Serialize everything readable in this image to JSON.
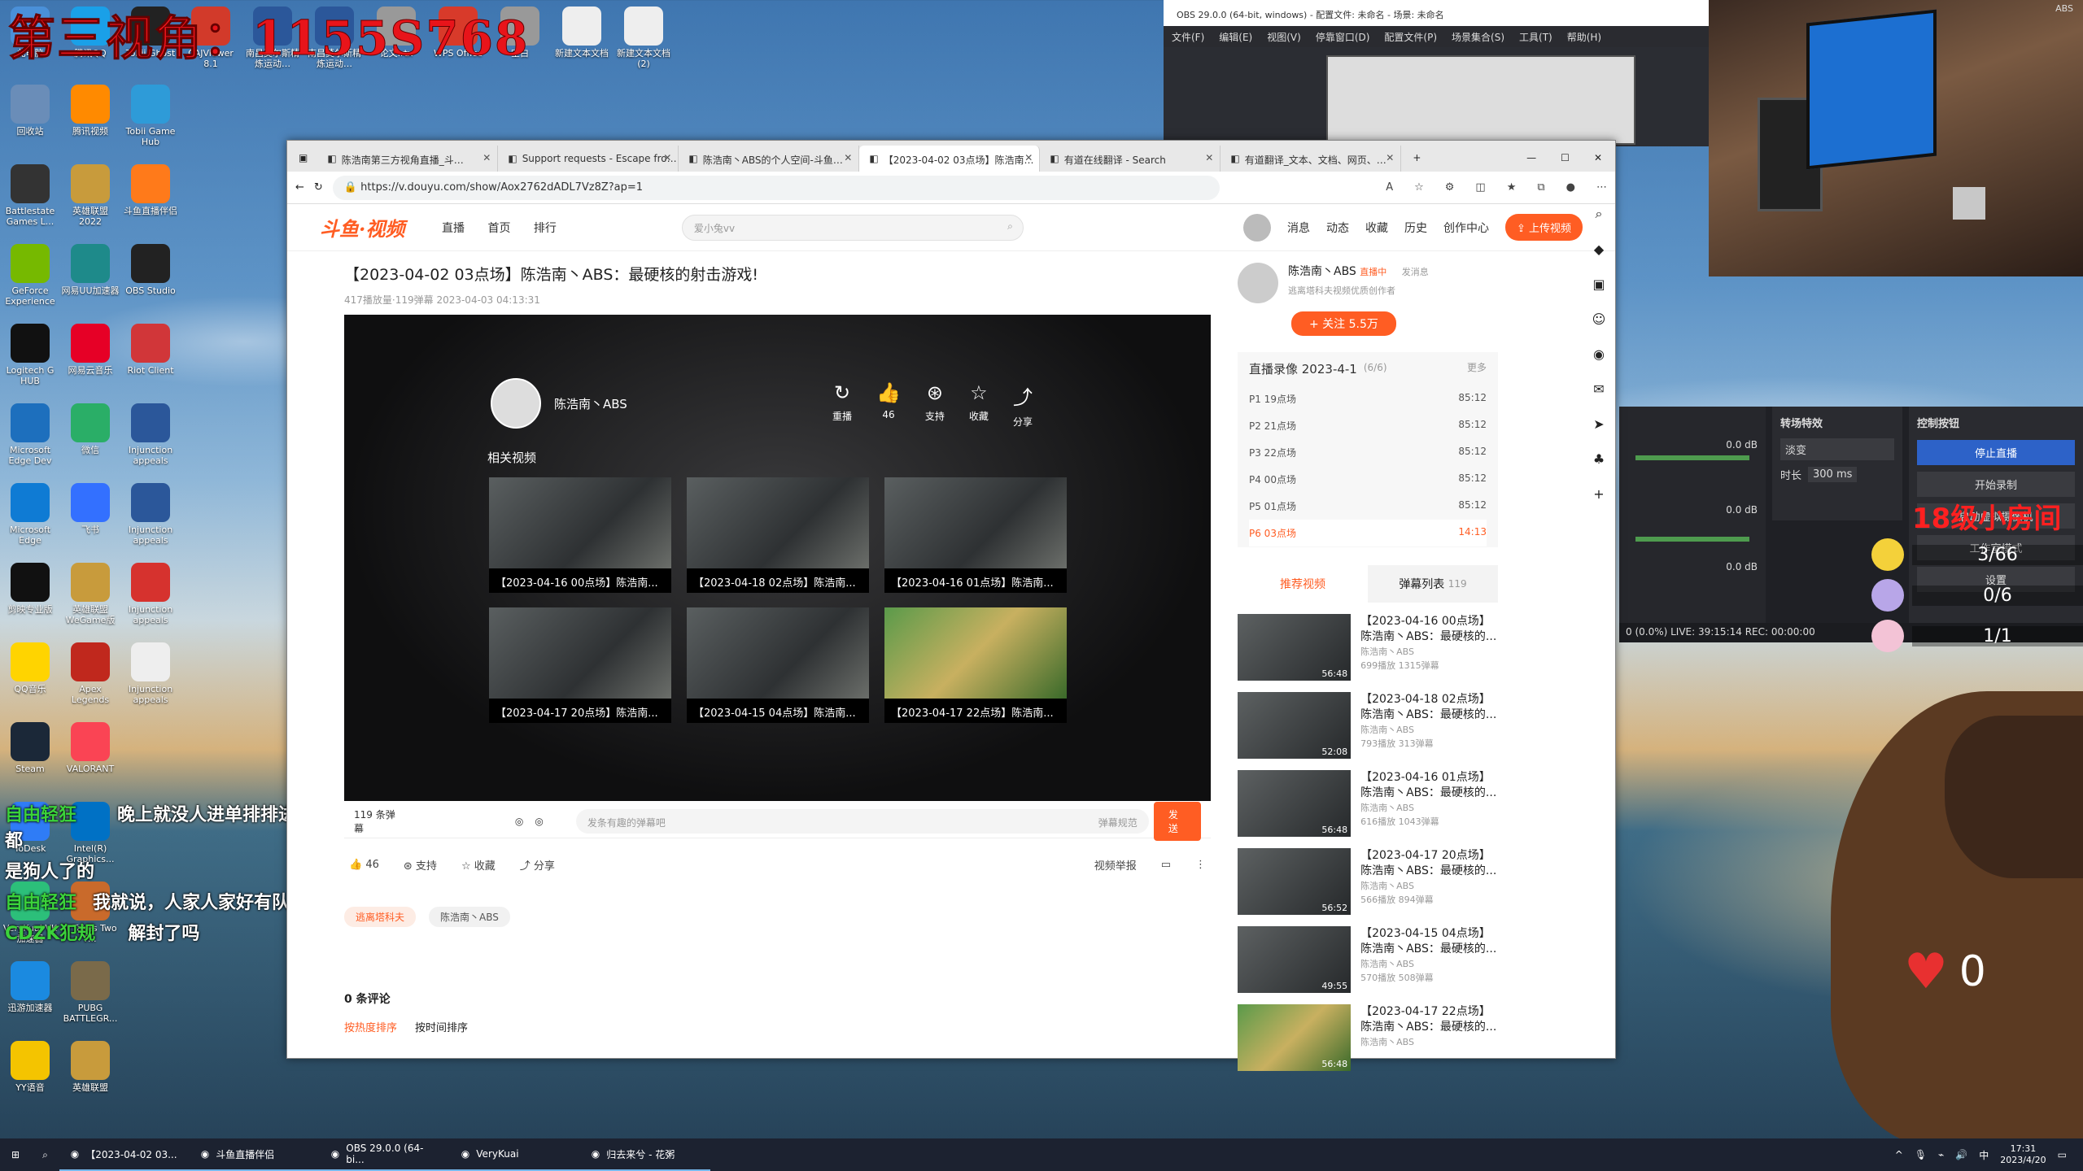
{
  "overlay_title": "第三视角：1155S768",
  "desktop_icons": [
    {
      "label": "此电脑",
      "icon": "computer-icon",
      "color": "#4a90d9"
    },
    {
      "label": "腾讯QQ",
      "icon": "qq-icon",
      "color": "#1aa0e8"
    },
    {
      "label": "Tobii Ghost",
      "icon": "tobii-icon",
      "color": "#222"
    },
    {
      "label": "CAJViewer 8.1",
      "icon": "caj-icon",
      "color": "#d23a2a"
    },
    {
      "label": "南昌莫尔斯精炼运动…",
      "icon": "word-doc-icon",
      "color": "#2b579a"
    },
    {
      "label": "南昌莫尔斯精炼运动…",
      "icon": "word-doc-icon",
      "color": "#2b579a"
    },
    {
      "label": "论文.rtx",
      "icon": "file-icon",
      "color": "#999"
    },
    {
      "label": "WPS Office",
      "icon": "wps-icon",
      "color": "#d83a2a"
    },
    {
      "label": "空白",
      "icon": "file-icon",
      "color": "#999"
    },
    {
      "label": "新建文本文档",
      "icon": "text-file-icon",
      "color": "#eee"
    },
    {
      "label": "新建文本文档 (2)",
      "icon": "text-file-icon",
      "color": "#eee"
    },
    {
      "label": "回收站",
      "icon": "recycle-bin-icon",
      "color": "#6a8db8"
    },
    {
      "label": "腾讯视频",
      "icon": "tencent-video-icon",
      "color": "#ff8a00"
    },
    {
      "label": "Tobii Game Hub",
      "icon": "tobii-hub-icon",
      "color": "#2e9bd8"
    },
    {
      "label": "Battlestate Games L...",
      "icon": "battlestate-icon",
      "color": "#333"
    },
    {
      "label": "英雄联盟 2022",
      "icon": "lol-icon",
      "color": "#c89b3c"
    },
    {
      "label": "斗鱼直播伴侣",
      "icon": "douyu-icon",
      "color": "#ff7a1a"
    },
    {
      "label": "GeForce Experience",
      "icon": "geforce-icon",
      "color": "#76b900"
    },
    {
      "label": "网易UU加速器",
      "icon": "uu-icon",
      "color": "#1e8a8a"
    },
    {
      "label": "OBS Studio",
      "icon": "obs-icon",
      "color": "#222"
    },
    {
      "label": "Logitech G HUB",
      "icon": "logitech-icon",
      "color": "#111"
    },
    {
      "label": "网易云音乐",
      "icon": "netease-music-icon",
      "color": "#e60026"
    },
    {
      "label": "Riot Client",
      "icon": "riot-icon",
      "color": "#d13639"
    },
    {
      "label": "Microsoft Edge Dev",
      "icon": "edge-dev-icon",
      "color": "#1d6fbd"
    },
    {
      "label": "微信",
      "icon": "wechat-icon",
      "color": "#2aae67"
    },
    {
      "label": "Injunction appeals",
      "icon": "word-doc-icon",
      "color": "#2b579a"
    },
    {
      "label": "Microsoft Edge",
      "icon": "edge-icon",
      "color": "#0f7bd4"
    },
    {
      "label": "飞书",
      "icon": "feishu-icon",
      "color": "#3370ff"
    },
    {
      "label": "Injunction appeals",
      "icon": "word-doc-icon",
      "color": "#2b579a"
    },
    {
      "label": "剪映专业版",
      "icon": "capcut-icon",
      "color": "#111"
    },
    {
      "label": "英雄联盟 WeGame版",
      "icon": "lol-icon",
      "color": "#c89b3c"
    },
    {
      "label": "Injunction appeals",
      "icon": "pdf-icon",
      "color": "#d6322e"
    },
    {
      "label": "QQ音乐",
      "icon": "qq-music-icon",
      "color": "#ffd400"
    },
    {
      "label": "Apex Legends",
      "icon": "apex-icon",
      "color": "#c0281d"
    },
    {
      "label": "Injunction appeals",
      "icon": "text-file-icon",
      "color": "#eee"
    },
    {
      "label": "Steam",
      "icon": "steam-icon",
      "color": "#1b2838"
    },
    {
      "label": "VALORANT",
      "icon": "valorant-icon",
      "color": "#fa4454"
    },
    {
      "label": "ToDesk",
      "icon": "todesk-icon",
      "color": "#2f7cf6"
    },
    {
      "label": "Intel(R) Graphics...",
      "icon": "intel-icon",
      "color": "#0071c5"
    },
    {
      "label": "VeryKuai VK 加速器",
      "icon": "verykuai-icon",
      "color": "#2cbf7a"
    },
    {
      "label": "It Takes Two F...",
      "icon": "ittakestwo-icon",
      "color": "#c96a2b"
    },
    {
      "label": "迅游加速器",
      "icon": "xunyou-icon",
      "color": "#1b8ae0"
    },
    {
      "label": "PUBG BATTLEGR...",
      "icon": "pubg-icon",
      "color": "#7a6a4a"
    },
    {
      "label": "YY语音",
      "icon": "yy-icon",
      "color": "#f4c400"
    },
    {
      "label": "英雄联盟",
      "icon": "lol-icon",
      "color": "#c89b3c"
    }
  ],
  "danmaku": [
    {
      "user": "自由轻狂",
      "text": "晚上就没人进单排排进图 全都"
    },
    {
      "user": "",
      "text": "是狗人了的"
    },
    {
      "user": "自由轻狂",
      "text": "我就说，人家人家好有队友"
    },
    {
      "user": "CDZK犯规",
      "text": "解封了吗"
    }
  ],
  "obs": {
    "title": "OBS 29.0.0 (64-bit, windows) - 配置文件: 未命名 - 场景: 未命名",
    "menu": [
      "文件(F)",
      "编辑(E)",
      "视图(V)",
      "停靠窗口(D)",
      "配置文件(P)",
      "场景集合(S)",
      "工具(T)",
      "帮助(H)"
    ],
    "transitions_title": "转场特效",
    "transition_value": "淡变",
    "duration_label": "时长",
    "duration_value": "300 ms",
    "controls_title": "控制按钮",
    "stop_stream": "停止直播",
    "start_record": "开始录制",
    "virtual_cam": "启动虚拟摄像机",
    "studio_mode": "工作室模式",
    "settings": "设置",
    "db_values": [
      "0.0 dB",
      "0.0 dB",
      "0.0 dB"
    ],
    "status": "0 (0.0%)   LIVE: 39:15:14   REC: 00:00:00",
    "overlay_room": "18级小房间",
    "counters": [
      "3/66",
      "0/6",
      "1/1"
    ],
    "heart_value": "0",
    "cam_heart_value": "0"
  },
  "browser": {
    "tabs": [
      {
        "title": "陈浩南第三方视角直播_斗…",
        "icon": "speaker-icon",
        "active": false
      },
      {
        "title": "Support requests - Escape fro…",
        "icon": "page-icon",
        "active": false
      },
      {
        "title": "陈浩南丶ABS的个人空间-斗鱼…",
        "icon": "douyu-icon",
        "active": false
      },
      {
        "title": "【2023-04-02 03点场】陈浩南…",
        "icon": "douyu-icon",
        "active": true
      },
      {
        "title": "有道在线翻译 - Search",
        "icon": "search-icon",
        "active": false
      },
      {
        "title": "有道翻译_文本、文档、网页、…",
        "icon": "youdao-icon",
        "active": false
      }
    ],
    "url": "https://v.douyu.com/show/Aox2762dADL7Vz8Z?ap=1"
  },
  "site": {
    "logo": "斗鱼·视频",
    "nav": [
      "直播",
      "首页",
      "排行"
    ],
    "search_placeholder": "爱小兔vv",
    "right_nav": [
      "消息",
      "动态",
      "收藏",
      "历史",
      "创作中心"
    ],
    "upload": "上传视频"
  },
  "video": {
    "title": "【2023-04-02 03点场】陈浩南丶ABS：最硬核的射击游戏!",
    "meta": "417播放量·119弹幕   2023-04-03 04:13:31",
    "uploader": "陈浩南丶ABS",
    "player_actions": [
      {
        "icon": "replay-icon",
        "label": "重播"
      },
      {
        "icon": "thumb-up-icon",
        "label": "46"
      },
      {
        "icon": "support-icon",
        "label": "支持"
      },
      {
        "icon": "star-icon",
        "label": "收藏"
      },
      {
        "icon": "share-icon",
        "label": "分享"
      }
    ],
    "related_header": "相关视频",
    "related": [
      "【2023-04-16 00点场】陈浩南...",
      "【2023-04-18 02点场】陈浩南...",
      "【2023-04-16 01点场】陈浩南...",
      "【2023-04-17 20点场】陈浩南...",
      "【2023-04-15 04点场】陈浩南...",
      "【2023-04-17 22点场】陈浩南..."
    ],
    "danmaku_count": "119 条弹幕",
    "danmaku_placeholder": "发条有趣的弹幕吧",
    "danmaku_rules": "弹幕规范",
    "send": "发送",
    "actions": [
      {
        "icon": "thumb-up-icon",
        "label": "46"
      },
      {
        "icon": "support-icon",
        "label": "支持"
      },
      {
        "icon": "star-icon",
        "label": "收藏"
      },
      {
        "icon": "share-icon",
        "label": "分享"
      }
    ],
    "report": "视频举报",
    "tags": [
      "逃离塔科夫",
      "陈浩南丶ABS"
    ],
    "comments": "0 条评论",
    "sort": [
      "按热度排序",
      "按时间排序"
    ]
  },
  "side": {
    "name": "陈浩南丶ABS",
    "live_badge": "直播中",
    "message": "发消息",
    "desc": "逃离塔科夫视频优质创作者",
    "follow": "+ 关注  5.5万",
    "playlist_title": "直播录像 2023-4-1",
    "playlist_count": "(6/6)",
    "more": "更多",
    "playlist": [
      {
        "name": "P1 19点场",
        "dur": "85:12",
        "active": false
      },
      {
        "name": "P2 21点场",
        "dur": "85:12",
        "active": false
      },
      {
        "name": "P3 22点场",
        "dur": "85:12",
        "active": false
      },
      {
        "name": "P4 00点场",
        "dur": "85:12",
        "active": false
      },
      {
        "name": "P5 01点场",
        "dur": "85:12",
        "active": false
      },
      {
        "name": "P6 03点场",
        "dur": "14:13",
        "active": true
      }
    ],
    "tab_rec": "推荐视频",
    "tab_dm": "弹幕列表",
    "tab_dm_count": "119",
    "recs": [
      {
        "title": "【2023-04-16 00点场】陈浩南丶ABS：最硬核的...",
        "author": "陈浩南丶ABS",
        "stats": "699播放   1315弹幕",
        "dur": "56:48"
      },
      {
        "title": "【2023-04-18 02点场】陈浩南丶ABS：最硬核的...",
        "author": "陈浩南丶ABS",
        "stats": "793播放   313弹幕",
        "dur": "52:08"
      },
      {
        "title": "【2023-04-16 01点场】陈浩南丶ABS：最硬核的...",
        "author": "陈浩南丶ABS",
        "stats": "616播放   1043弹幕",
        "dur": "56:48"
      },
      {
        "title": "【2023-04-17 20点场】陈浩南丶ABS：最硬核的...",
        "author": "陈浩南丶ABS",
        "stats": "566播放   894弹幕",
        "dur": "56:52"
      },
      {
        "title": "【2023-04-15 04点场】陈浩南丶ABS：最硬核的...",
        "author": "陈浩南丶ABS",
        "stats": "570播放   508弹幕",
        "dur": "49:55"
      },
      {
        "title": "【2023-04-17 22点场】陈浩南丶ABS：最硬核的...",
        "author": "陈浩南丶ABS",
        "stats": "",
        "dur": "56:48"
      }
    ]
  },
  "taskbar": {
    "items": [
      {
        "label": "【2023-04-02 03...",
        "icon": "edge-icon"
      },
      {
        "label": "斗鱼直播伴侣",
        "icon": "douyu-icon"
      },
      {
        "label": "OBS 29.0.0 (64-bi...",
        "icon": "obs-icon"
      },
      {
        "label": "VeryKuai",
        "icon": "verykuai-icon"
      },
      {
        "label": "归去来兮 - 花粥",
        "icon": "netease-music-icon"
      }
    ],
    "ime": "中",
    "time": "17:31",
    "date": "2023/4/20"
  }
}
